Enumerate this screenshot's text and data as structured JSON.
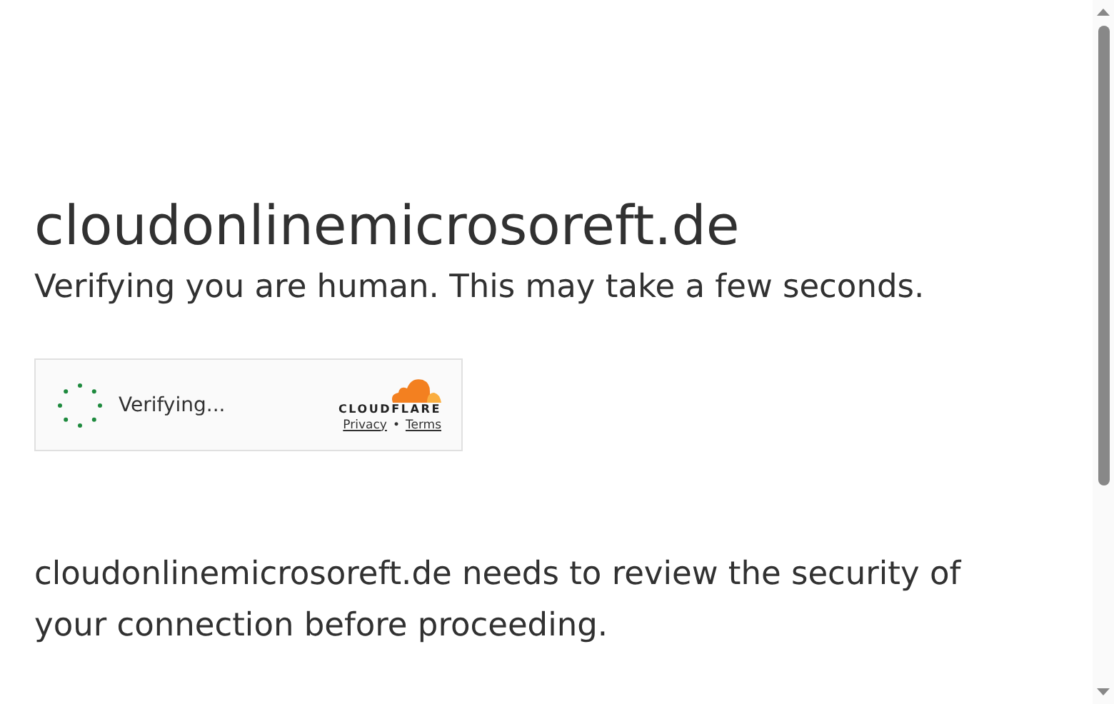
{
  "heading": "cloudonlinemicrosoreft.de",
  "subheading": "Verifying you are human. This may take a few seconds.",
  "widget": {
    "status": "Verifying...",
    "logo_text": "CLOUDFLARE",
    "links": [
      "Privacy",
      "Terms"
    ],
    "separator": "•"
  },
  "message": "cloudonlinemicrosoreft.de needs to review the security of your connection before proceeding."
}
